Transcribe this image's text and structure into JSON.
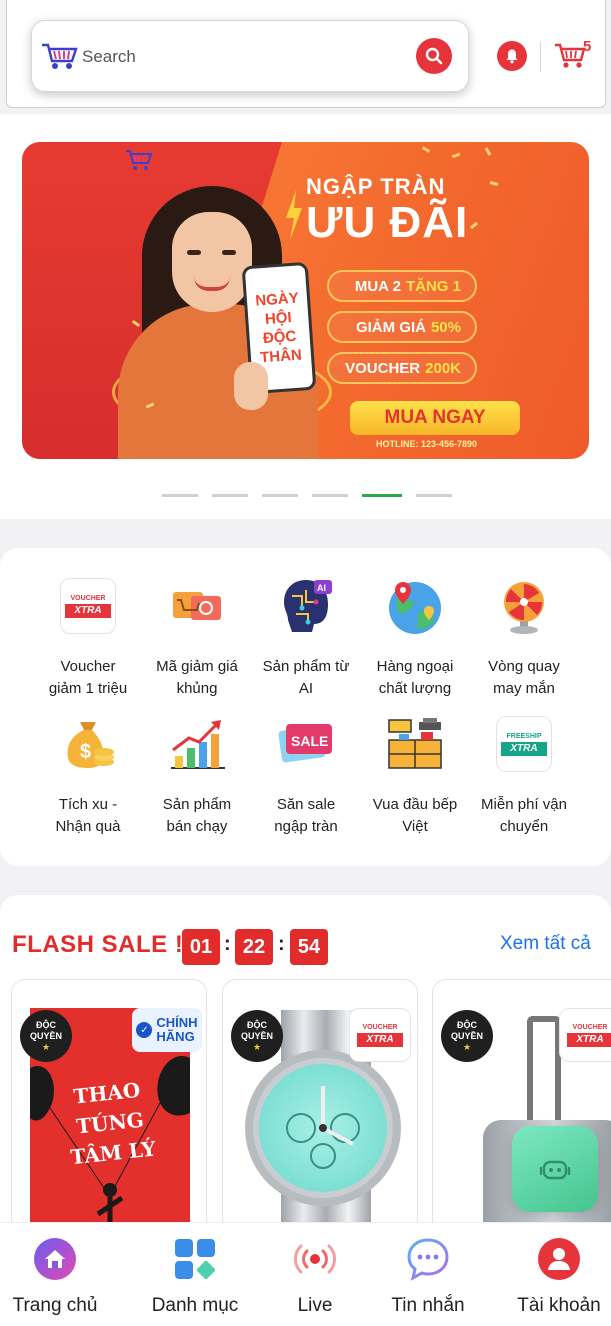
{
  "header": {
    "search_placeholder": "Search",
    "cart_count": "5"
  },
  "banner": {
    "title_line1": "NGẬP TRÀN",
    "title_line2": "ƯU ĐÃI",
    "phone_text": [
      "NGÀY",
      "HỘI",
      "ĐỘC",
      "THÂN"
    ],
    "offers": [
      {
        "prefix": "MUA 2",
        "highlight": "TẶNG 1"
      },
      {
        "prefix": "GIẢM GIÁ",
        "highlight": "50%"
      },
      {
        "prefix": "VOUCHER",
        "highlight": "200K"
      }
    ],
    "cta": "MUA NGAY",
    "hotline": "HOTLINE: 123-456-7890",
    "slide_count": 6,
    "active_slide": 5
  },
  "categories": [
    {
      "line1": "Voucher",
      "line2": "giảm 1 triệu",
      "icon": "voucher-xtra-icon"
    },
    {
      "line1": "Mã giảm giá",
      "line2": "khủng",
      "icon": "coupon-cart-icon"
    },
    {
      "line1": "Sản phẩm từ",
      "line2": "AI",
      "icon": "ai-brain-icon"
    },
    {
      "line1": "Hàng ngoại",
      "line2": "chất lượng",
      "icon": "globe-pin-icon"
    },
    {
      "line1": "Vòng quay",
      "line2": "may mắn",
      "icon": "lucky-wheel-icon"
    },
    {
      "line1": "Tích xu -",
      "line2": "Nhận quà",
      "icon": "money-bag-icon"
    },
    {
      "line1": "Sản phẩm",
      "line2": "bán chạy",
      "icon": "bar-chart-trend-icon"
    },
    {
      "line1": "Săn sale",
      "line2": "ngập tràn",
      "icon": "sale-tag-icon"
    },
    {
      "line1": "Vua đầu bếp",
      "line2": "Việt",
      "icon": "kitchen-icon"
    },
    {
      "line1": "Miễn phí vận",
      "line2": "chuyển",
      "icon": "freeship-xtra-icon"
    }
  ],
  "xtra": {
    "voucher": "VOUCHER",
    "freeship": "FREESHIP",
    "brand": "XTRA"
  },
  "flash_sale": {
    "title": "FLASH SALE !",
    "hours": "01",
    "minutes": "22",
    "seconds": "54",
    "separator": ":",
    "see_all": "Xem tất cả",
    "badge_line1": "ĐỘC",
    "badge_line2": "QUYỀN",
    "badge_star": "★",
    "genuine_line1": "CHÍNH",
    "genuine_line2": "HÃNG",
    "book_title_line1": "THAO TÚNG",
    "book_title_line2": "TÂM LÝ"
  },
  "bottom_nav": [
    {
      "label": "Trang chủ",
      "icon": "home-icon"
    },
    {
      "label": "Danh mục",
      "icon": "category-grid-icon"
    },
    {
      "label": "Live",
      "icon": "live-broadcast-icon"
    },
    {
      "label": "Tin nhắn",
      "icon": "chat-bubble-icon"
    },
    {
      "label": "Tài khoản",
      "icon": "user-account-icon"
    }
  ],
  "colors": {
    "accent_red": "#e6343b",
    "link_blue": "#1a73e8",
    "active_dot": "#2ea84a"
  }
}
